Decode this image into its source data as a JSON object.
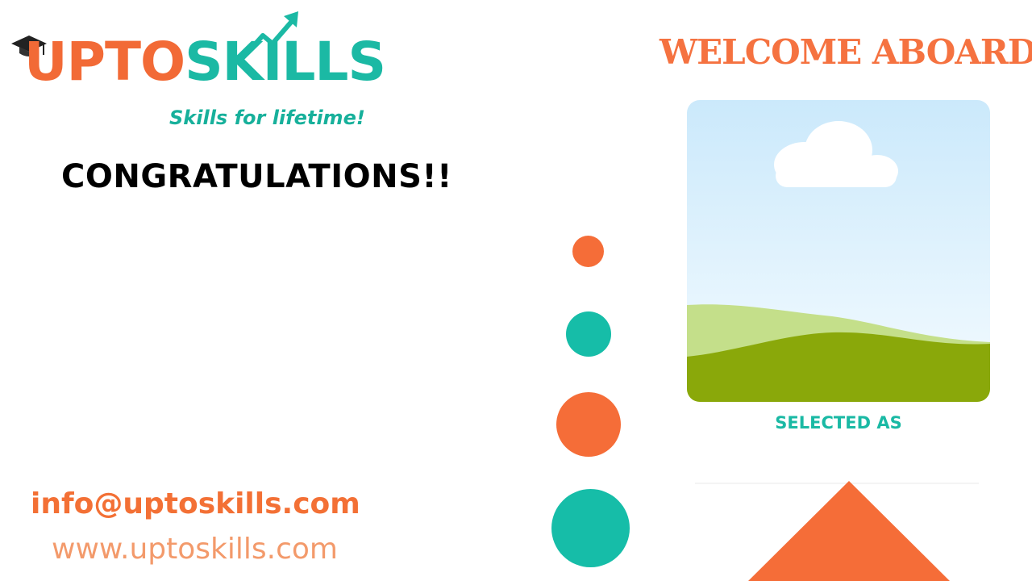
{
  "logo": {
    "name_part1": "UPTO",
    "name_part2": "SKILLS",
    "tagline": "Skills for lifetime!"
  },
  "headline": "CONGRATULATIONS!!",
  "welcome_title": "WELCOME ABOARD",
  "photo_placeholder": {
    "icon": "image-placeholder-icon"
  },
  "selected_label": "SELECTED AS",
  "contact": {
    "email": "info@uptoskills.com",
    "website": "www.uptoskills.com"
  },
  "colors": {
    "brand_orange": "#f56d38",
    "brand_teal": "#16bda8",
    "text_black": "#000000"
  }
}
